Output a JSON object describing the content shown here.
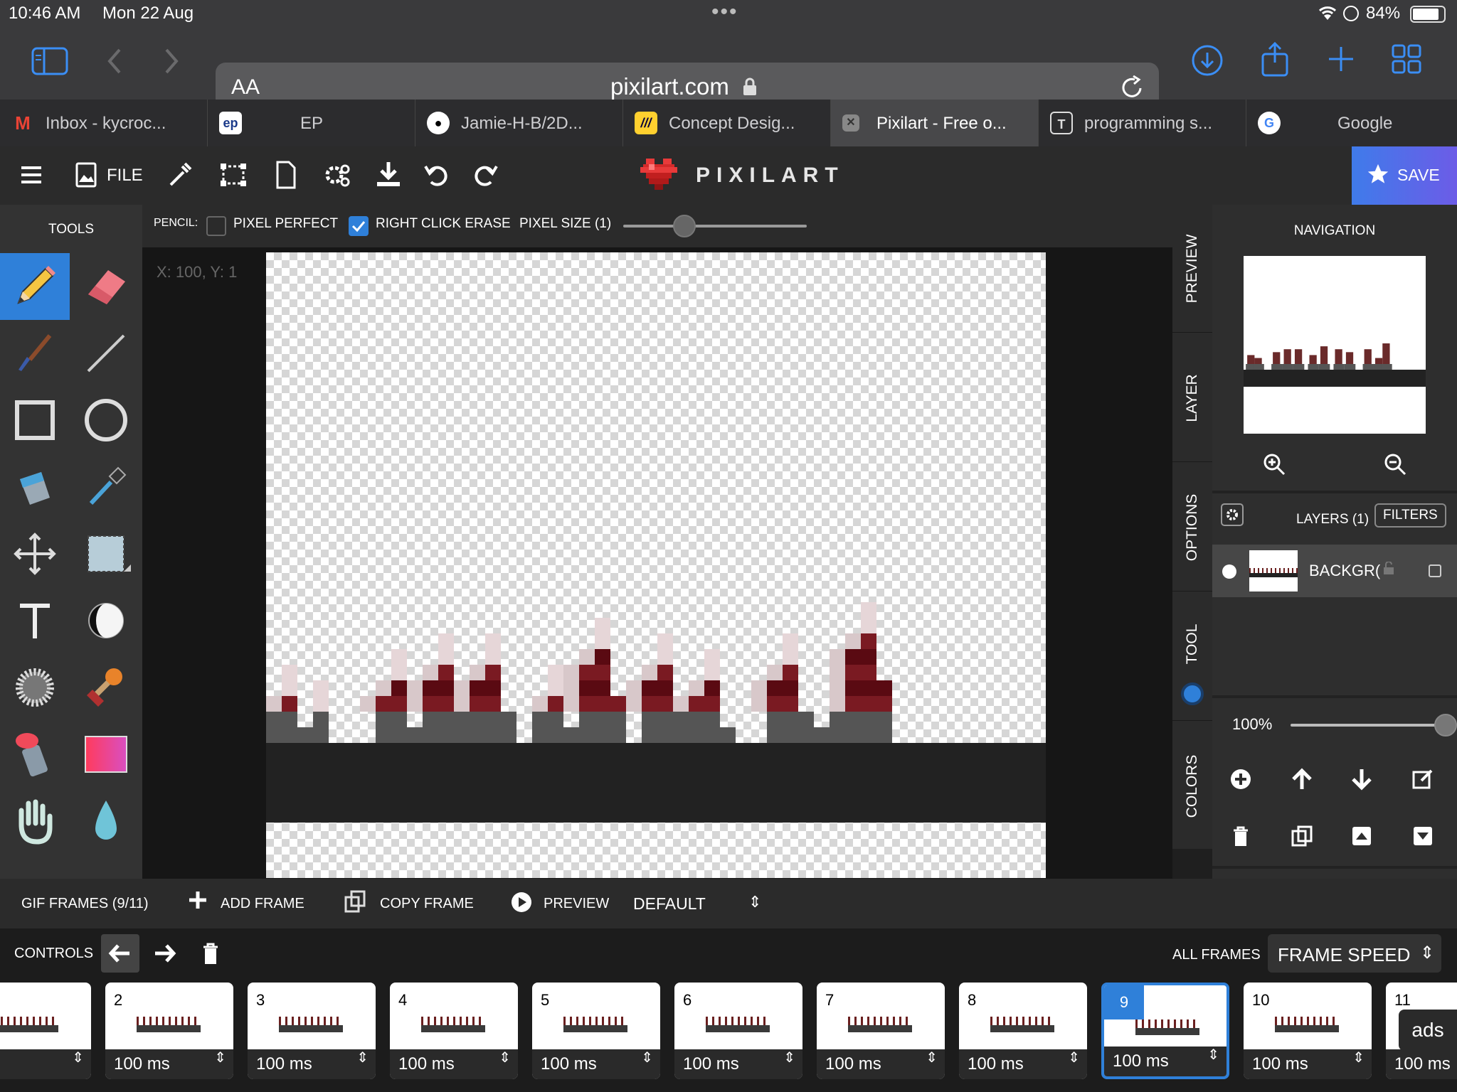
{
  "status": {
    "time": "10:46 AM",
    "date": "Mon 22 Aug",
    "battery": "84%"
  },
  "browser": {
    "text_size_label": "AA",
    "url": "pixilart.com",
    "tabs": [
      {
        "title": "Inbox - kycroc...",
        "icon": "gmail-icon"
      },
      {
        "title": "EP",
        "icon": "ep-icon"
      },
      {
        "title": "Jamie-H-B/2D...",
        "icon": "github-icon"
      },
      {
        "title": "Concept Desig...",
        "icon": "miro-icon"
      },
      {
        "title": "Pixilart - Free o...",
        "icon": "close-icon",
        "active": true
      },
      {
        "title": "programming s...",
        "icon": "t-icon"
      },
      {
        "title": "Google",
        "icon": "google-icon"
      }
    ]
  },
  "app": {
    "file_label": "FILE",
    "logo_text": "PIXILART",
    "save_label": "SAVE",
    "tools_label": "TOOLS",
    "pencil_label": "PENCIL:",
    "pixel_perfect_label": "PIXEL PERFECT",
    "pixel_perfect_checked": false,
    "right_click_erase_label": "RIGHT CLICK ERASE",
    "right_click_erase_checked": true,
    "pixel_size_label": "PIXEL SIZE (1)",
    "pixel_size_value": 1,
    "coords": "X: 100, Y: 1",
    "accent": "#2f80d9"
  },
  "side_tabs": [
    "PREVIEW",
    "LAYER",
    "OPTIONS",
    "TOOL",
    "COLORS"
  ],
  "right_panel": {
    "navigation_label": "NAVIGATION",
    "layers_label": "LAYERS (1)",
    "filters_label": "FILTERS",
    "layer_name": "BACKGR(",
    "opacity_label": "100%",
    "opacity_value": 1.0
  },
  "gif": {
    "frames_label": "GIF FRAMES (9/11)",
    "add_frame_label": "ADD FRAME",
    "copy_frame_label": "COPY FRAME",
    "preview_label": "PREVIEW",
    "mode_label": "DEFAULT",
    "controls_label": "CONTROLS",
    "all_frames_label": "ALL FRAMES",
    "frame_speed_label": "FRAME SPEED",
    "ads_label": "ads",
    "frames": [
      {
        "num": "",
        "speed": "ms"
      },
      {
        "num": "2",
        "speed": "100 ms"
      },
      {
        "num": "3",
        "speed": "100 ms"
      },
      {
        "num": "4",
        "speed": "100 ms"
      },
      {
        "num": "5",
        "speed": "100 ms"
      },
      {
        "num": "6",
        "speed": "100 ms"
      },
      {
        "num": "7",
        "speed": "100 ms"
      },
      {
        "num": "8",
        "speed": "100 ms"
      },
      {
        "num": "9",
        "speed": "100 ms",
        "selected": true
      },
      {
        "num": "10",
        "speed": "100 ms"
      },
      {
        "num": "11",
        "speed": "100 ms"
      }
    ]
  }
}
